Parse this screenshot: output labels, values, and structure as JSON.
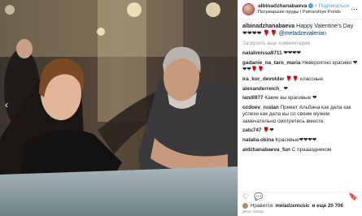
{
  "post": {
    "author": "albinadzhanabaeva",
    "verified_mark": "✓",
    "separator": "•",
    "follow_label": "Подписаться",
    "location": "Патриаршие пруды | Patriarshiye Ponds",
    "more_icon": "more-horizontal-icon",
    "caption_user": "albinadzhanabaeva",
    "caption_text": "Happy Valentine's Day ❤❤❤❤ 🌹🌹",
    "caption_mention": "@meladzevalerian",
    "load_more": "Загрузить еще комментарии"
  },
  "comments": [
    {
      "user": "natalimissa9711",
      "text": "❤❤❤❤"
    },
    {
      "user": "gadanie_na_taro_maria",
      "text": "Невероятно красиво ❤❤❤🌹🌹"
    },
    {
      "user": "ira_kor_devolder",
      "text": "🌹🌹 классные"
    },
    {
      "user": "alexanderreich_",
      "text": "❤"
    },
    {
      "user": "landi977",
      "text": "Какие вы красивые ❤"
    },
    {
      "user": "ozdoev_ruslan",
      "text": "Привет Альбина как дела как успехи как дела вы со своим мужем замечательно смотретесь вместе."
    },
    {
      "user": "zatu747",
      "text": "🌹❤"
    },
    {
      "user": "natalia.okina",
      "text": "Красивые❤❤❤❤"
    },
    {
      "user": "aldzhanabaeva_fun",
      "text": "С праааздником"
    }
  ],
  "footer": {
    "likes_prefix": "Нравится",
    "likes_user": "meladzemusic",
    "likes_suffix": "и еще 20 706",
    "date": "день назад"
  },
  "icons": {
    "like": "heart-icon",
    "comment": "comment-icon",
    "save": "bookmark-icon",
    "nav": "chevron-left-icon"
  }
}
